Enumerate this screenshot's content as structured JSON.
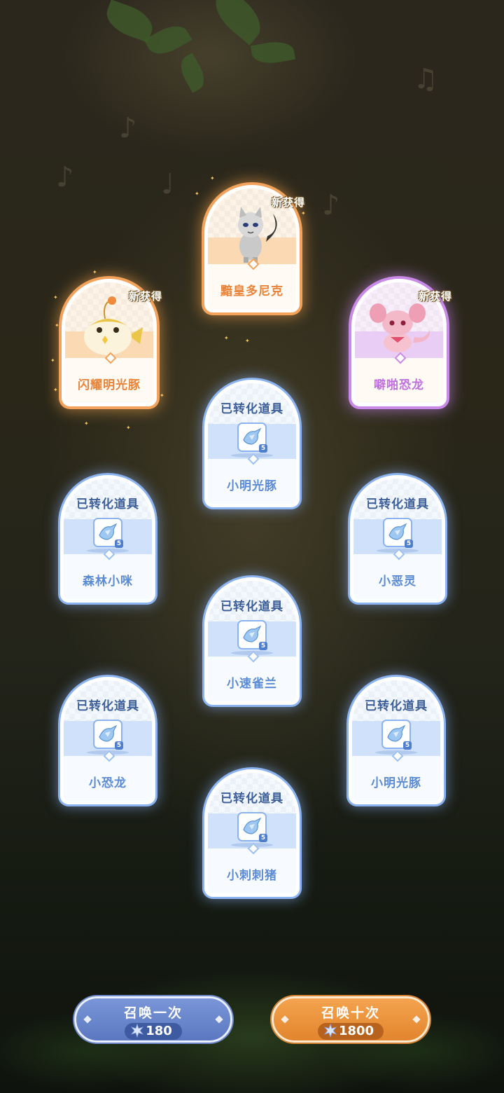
{
  "colors": {
    "blue_accent": "#8ab3f0",
    "orange_accent": "#f2a25a",
    "purple_accent": "#c989e6"
  },
  "new_label": "新获得",
  "converted_label": "已转化道具",
  "featured": [
    {
      "name": "黯皇多尼克",
      "rarity": "orange",
      "new": true
    },
    {
      "name": "闪耀明光豚",
      "rarity": "orange",
      "new": true
    },
    {
      "name": "噼啪恐龙",
      "rarity": "purple",
      "new": true
    }
  ],
  "converted": [
    {
      "name": "小明光豚",
      "item_icon": "crystal-bird-icon",
      "qty": "5"
    },
    {
      "name": "森林小咪",
      "item_icon": "crystal-bird-icon",
      "qty": "5"
    },
    {
      "name": "小恶灵",
      "item_icon": "crystal-bird-icon",
      "qty": "5"
    },
    {
      "name": "小速雀兰",
      "item_icon": "crystal-bird-icon",
      "qty": "5"
    },
    {
      "name": "小恐龙",
      "item_icon": "crystal-bird-icon",
      "qty": "5"
    },
    {
      "name": "小明光豚",
      "item_icon": "crystal-bird-icon",
      "qty": "5"
    },
    {
      "name": "小刺刺猪",
      "item_icon": "crystal-bird-icon",
      "qty": "5"
    }
  ],
  "buttons": {
    "summon_one": {
      "label": "召唤一次",
      "cost": "180",
      "currency_icon": "snowflake-crystal-icon"
    },
    "summon_ten": {
      "label": "召唤十次",
      "cost": "1800",
      "currency_icon": "snowflake-crystal-icon"
    }
  }
}
